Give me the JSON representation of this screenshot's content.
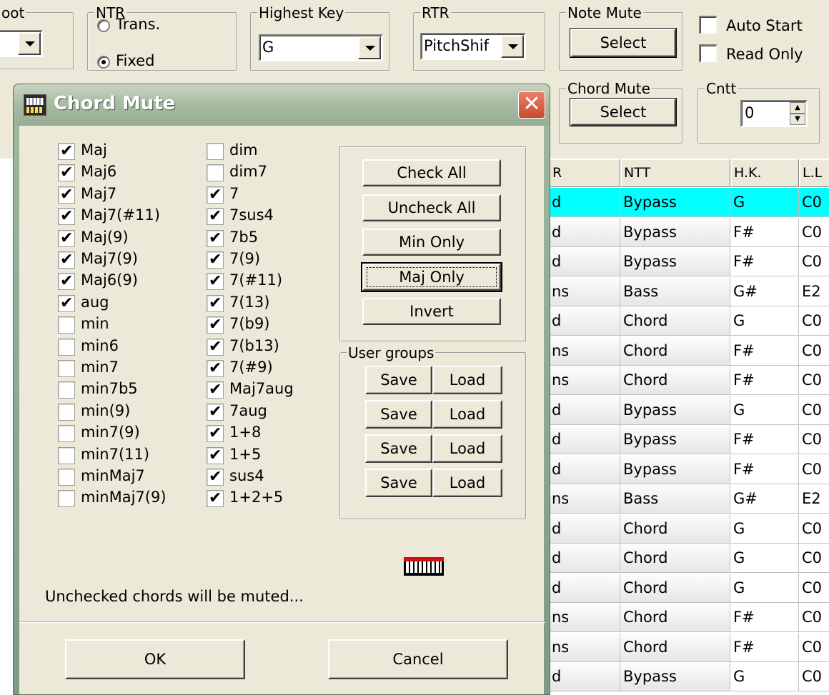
{
  "app": {
    "root": {
      "legend": "oot"
    },
    "ntr": {
      "legend": "NTR",
      "opt_trans": "Trans.",
      "opt_fixed": "Fixed"
    },
    "highest_key": {
      "legend": "Highest Key",
      "value": "G"
    },
    "rtr": {
      "legend": "RTR",
      "value": "PitchShif"
    },
    "note_mute": {
      "legend": "Note Mute",
      "button": "Select"
    },
    "chord_mute": {
      "legend": "Chord Mute",
      "button": "Select"
    },
    "cntt": {
      "legend": "Cntt",
      "value": "0"
    },
    "auto_start": "Auto Start",
    "read_only": "Read Only",
    "grid": {
      "headers": [
        "R",
        "NTT",
        "H.K.",
        "L.L"
      ],
      "rows": [
        [
          "d",
          "Bypass",
          "G",
          "C0"
        ],
        [
          "d",
          "Bypass",
          "F#",
          "C0"
        ],
        [
          "d",
          "Bypass",
          "F#",
          "C0"
        ],
        [
          "ns",
          "Bass",
          "G#",
          "E2"
        ],
        [
          "d",
          "Chord",
          "G",
          "C0"
        ],
        [
          "ns",
          "Chord",
          "F#",
          "C0"
        ],
        [
          "ns",
          "Chord",
          "F#",
          "C0"
        ],
        [
          "d",
          "Bypass",
          "G",
          "C0"
        ],
        [
          "d",
          "Bypass",
          "F#",
          "C0"
        ],
        [
          "d",
          "Bypass",
          "F#",
          "C0"
        ],
        [
          "ns",
          "Bass",
          "G#",
          "E2"
        ],
        [
          "d",
          "Chord",
          "G",
          "C0"
        ],
        [
          "d",
          "Chord",
          "G",
          "C0"
        ],
        [
          "d",
          "Chord",
          "G",
          "C0"
        ],
        [
          "ns",
          "Chord",
          "F#",
          "C0"
        ],
        [
          "ns",
          "Chord",
          "F#",
          "C0"
        ],
        [
          "d",
          "Bypass",
          "G",
          "C0"
        ]
      ]
    }
  },
  "dialog": {
    "title": "Chord Mute",
    "close_glyph": "✕",
    "col1": [
      {
        "label": "Maj",
        "checked": true
      },
      {
        "label": "Maj6",
        "checked": true
      },
      {
        "label": "Maj7",
        "checked": true
      },
      {
        "label": "Maj7(#11)",
        "checked": true
      },
      {
        "label": "Maj(9)",
        "checked": true
      },
      {
        "label": "Maj7(9)",
        "checked": true
      },
      {
        "label": "Maj6(9)",
        "checked": true
      },
      {
        "label": "aug",
        "checked": true
      },
      {
        "label": "min",
        "checked": false
      },
      {
        "label": "min6",
        "checked": false
      },
      {
        "label": "min7",
        "checked": false
      },
      {
        "label": "min7b5",
        "checked": false
      },
      {
        "label": "min(9)",
        "checked": false
      },
      {
        "label": "min7(9)",
        "checked": false
      },
      {
        "label": "min7(11)",
        "checked": false
      },
      {
        "label": "minMaj7",
        "checked": false
      },
      {
        "label": "minMaj7(9)",
        "checked": false
      }
    ],
    "col2": [
      {
        "label": "dim",
        "checked": false
      },
      {
        "label": "dim7",
        "checked": false
      },
      {
        "label": "7",
        "checked": true
      },
      {
        "label": "7sus4",
        "checked": true
      },
      {
        "label": "7b5",
        "checked": true
      },
      {
        "label": "7(9)",
        "checked": true
      },
      {
        "label": "7(#11)",
        "checked": true
      },
      {
        "label": "7(13)",
        "checked": true
      },
      {
        "label": "7(b9)",
        "checked": true
      },
      {
        "label": "7(b13)",
        "checked": true
      },
      {
        "label": "7(#9)",
        "checked": true
      },
      {
        "label": "Maj7aug",
        "checked": true
      },
      {
        "label": "7aug",
        "checked": true
      },
      {
        "label": "1+8",
        "checked": true
      },
      {
        "label": "1+5",
        "checked": true
      },
      {
        "label": "sus4",
        "checked": true
      },
      {
        "label": "1+2+5",
        "checked": true
      }
    ],
    "check_all": "Check All",
    "uncheck_all": "Uncheck All",
    "min_only": "Min Only",
    "maj_only": "Maj Only",
    "invert": "Invert",
    "user_groups": "User groups",
    "save": "Save",
    "load": "Load",
    "note": "Unchecked chords will be muted...",
    "ok": "OK",
    "cancel": "Cancel"
  }
}
